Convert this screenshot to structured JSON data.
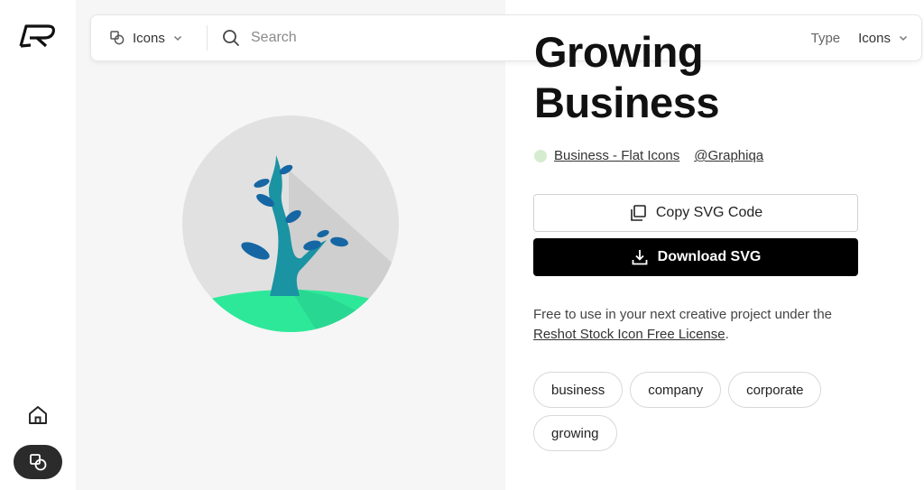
{
  "search": {
    "placeholder": "Search",
    "scope_label": "Icons"
  },
  "filter": {
    "type_label": "Type",
    "type_value": "Icons"
  },
  "asset": {
    "title_line1": "Growing",
    "title_line2": "Business",
    "collection": "Business - Flat Icons",
    "author": "@Graphiqa"
  },
  "actions": {
    "copy_label": "Copy SVG Code",
    "download_label": "Download SVG"
  },
  "license": {
    "text_before": "Free to use in your next creative project under the ",
    "link": "Reshot Stock Icon Free License",
    "text_after": "."
  },
  "tags": [
    "business",
    "company",
    "corporate",
    "growing"
  ],
  "colors": {
    "circle": "#e1e1e1",
    "shadow": "#cfcfcf",
    "grass": "#2ee89a",
    "trunk": "#1a93a3",
    "leaf": "#1566a3",
    "download_bg": "#000000"
  },
  "icons": {
    "logo": "reshot-logo",
    "scope": "icons-shapes-icon",
    "search": "search-icon",
    "chevron": "chevron-down-icon",
    "copy": "copy-icon",
    "download": "download-icon",
    "home": "home-icon",
    "icons_nav": "icons-shapes-icon"
  }
}
